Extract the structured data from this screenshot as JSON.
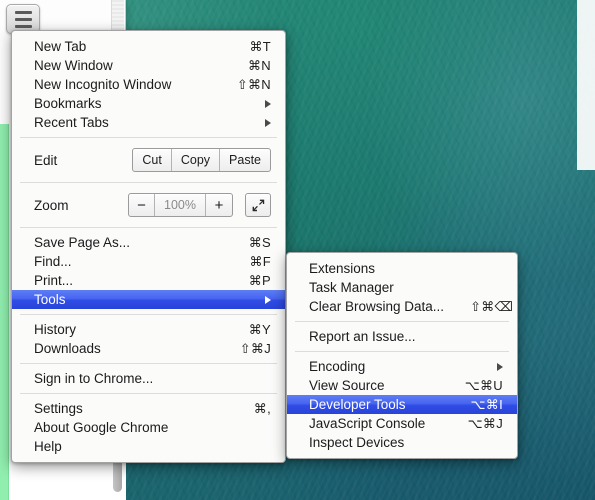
{
  "desktop": {
    "wallpaper_name": "ocean-water-wallpaper",
    "wallpaper_color": "#1c7a70"
  },
  "menu_button": {
    "name": "chrome-menu-button",
    "icon": "hamburger-icon"
  },
  "main_menu": {
    "groups": [
      {
        "type": "items",
        "items": [
          {
            "label": "New Tab",
            "accel": "⌘T",
            "arrow": false,
            "selected": false
          },
          {
            "label": "New Window",
            "accel": "⌘N",
            "arrow": false,
            "selected": false
          },
          {
            "label": "New Incognito Window",
            "accel": "⇧⌘N",
            "arrow": false,
            "selected": false
          },
          {
            "label": "Bookmarks",
            "accel": "",
            "arrow": true,
            "selected": false
          },
          {
            "label": "Recent Tabs",
            "accel": "",
            "arrow": true,
            "selected": false
          }
        ]
      },
      {
        "type": "edit_row",
        "label": "Edit",
        "buttons": [
          "Cut",
          "Copy",
          "Paste"
        ]
      },
      {
        "type": "zoom_row",
        "label": "Zoom",
        "minus": "−",
        "value": "100%",
        "plus": "+",
        "fullscreen_icon": "fullscreen-arrows-icon"
      },
      {
        "type": "items",
        "items": [
          {
            "label": "Save Page As...",
            "accel": "⌘S",
            "arrow": false,
            "selected": false
          },
          {
            "label": "Find...",
            "accel": "⌘F",
            "arrow": false,
            "selected": false
          },
          {
            "label": "Print...",
            "accel": "⌘P",
            "arrow": false,
            "selected": false
          },
          {
            "label": "Tools",
            "accel": "",
            "arrow": true,
            "selected": true
          }
        ]
      },
      {
        "type": "items",
        "items": [
          {
            "label": "History",
            "accel": "⌘Y",
            "arrow": false,
            "selected": false
          },
          {
            "label": "Downloads",
            "accel": "⇧⌘J",
            "arrow": false,
            "selected": false
          }
        ]
      },
      {
        "type": "items",
        "items": [
          {
            "label": "Sign in to Chrome...",
            "accel": "",
            "arrow": false,
            "selected": false
          }
        ]
      },
      {
        "type": "items",
        "items": [
          {
            "label": "Settings",
            "accel": "⌘,",
            "arrow": false,
            "selected": false
          },
          {
            "label": "About Google Chrome",
            "accel": "",
            "arrow": false,
            "selected": false
          },
          {
            "label": "Help",
            "accel": "",
            "arrow": false,
            "selected": false
          }
        ]
      }
    ]
  },
  "tools_submenu": {
    "groups": [
      {
        "items": [
          {
            "label": "Extensions",
            "accel": "",
            "arrow": false,
            "selected": false
          },
          {
            "label": "Task Manager",
            "accel": "",
            "arrow": false,
            "selected": false
          },
          {
            "label": "Clear Browsing Data...",
            "accel": "⇧⌘⌫",
            "arrow": false,
            "selected": false
          }
        ]
      },
      {
        "items": [
          {
            "label": "Report an Issue...",
            "accel": "",
            "arrow": false,
            "selected": false
          }
        ]
      },
      {
        "items": [
          {
            "label": "Encoding",
            "accel": "",
            "arrow": true,
            "selected": false
          },
          {
            "label": "View Source",
            "accel": "⌥⌘U",
            "arrow": false,
            "selected": false
          },
          {
            "label": "Developer Tools",
            "accel": "⌥⌘I",
            "arrow": false,
            "selected": true
          },
          {
            "label": "JavaScript Console",
            "accel": "⌥⌘J",
            "arrow": false,
            "selected": false
          },
          {
            "label": "Inspect Devices",
            "accel": "",
            "arrow": false,
            "selected": false
          }
        ]
      }
    ]
  },
  "colors": {
    "selection_blue": "#2f4ce6",
    "menu_background": "#fbfbfa",
    "accent_green_bar": "#90eeae"
  }
}
